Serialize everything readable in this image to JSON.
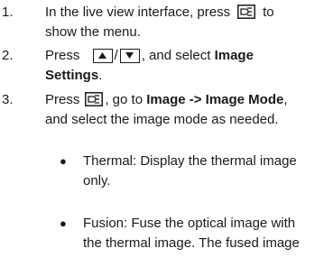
{
  "steps": [
    {
      "number": "1.",
      "line1_before": "In the live view interface, press",
      "line1_after": "to",
      "line2": "show the menu.",
      "icon": "menu-icon"
    },
    {
      "number": "2.",
      "press": "Press",
      "separator": "/",
      "after_keys": ", and select",
      "bold1": "Image",
      "bold2": "Settings",
      "end": ".",
      "icons": [
        "up-key-icon",
        "down-key-icon"
      ]
    },
    {
      "number": "3.",
      "press": "Press",
      "mid": ", go to",
      "bold": "Image -> Image Mode",
      "comma": ",",
      "line2": "and select the image mode as needed.",
      "icon": "menu-icon"
    }
  ],
  "bullets": [
    {
      "symbol": "●",
      "line1": "Thermal: Display the thermal image",
      "line2": "only."
    },
    {
      "symbol": "●",
      "line1": "Fusion: Fuse the optical image with",
      "line2": "the thermal image. The fused image"
    }
  ]
}
